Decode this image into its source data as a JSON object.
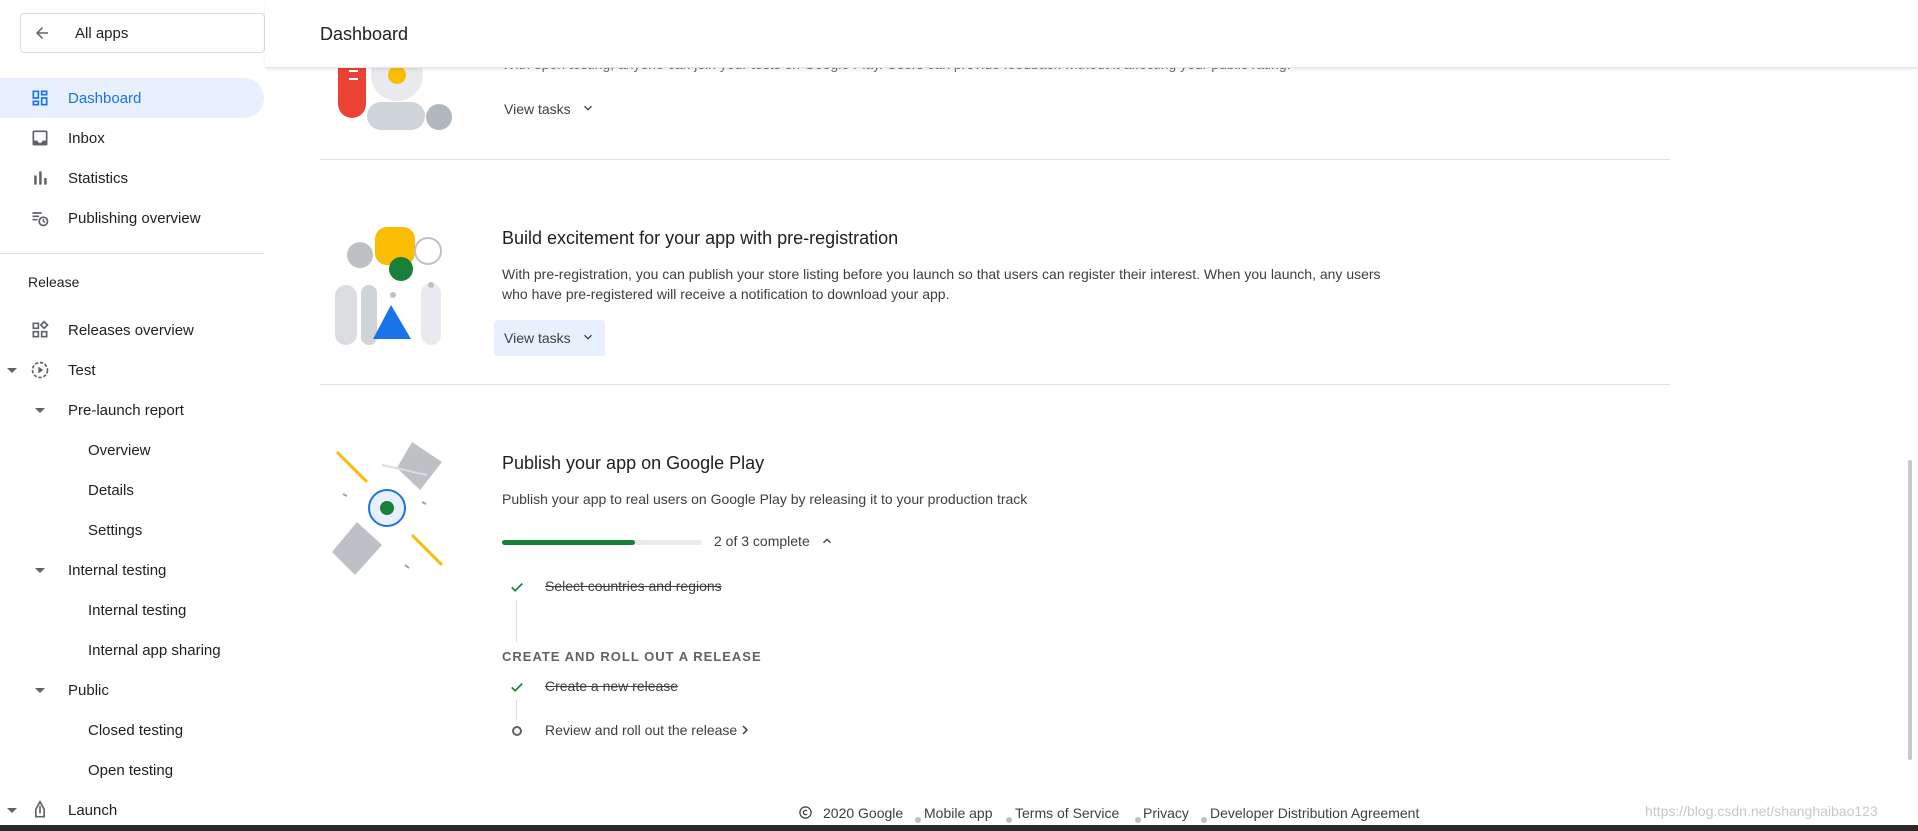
{
  "app": {
    "all_apps_label": "All apps",
    "page_title": "Dashboard"
  },
  "sidebar": {
    "items": [
      {
        "label": "Dashboard",
        "icon": "dashboard-icon"
      },
      {
        "label": "Inbox",
        "icon": "inbox-icon"
      },
      {
        "label": "Statistics",
        "icon": "bar-chart-icon"
      },
      {
        "label": "Publishing overview",
        "icon": "publishing-icon"
      }
    ],
    "release_section": "Release",
    "release_items": [
      {
        "label": "Releases overview",
        "icon": "releases-icon"
      },
      {
        "label": "Test",
        "icon": "play-icon"
      },
      {
        "label": "Pre-launch report"
      },
      {
        "label": "Overview"
      },
      {
        "label": "Details"
      },
      {
        "label": "Settings"
      },
      {
        "label": "Internal testing"
      },
      {
        "label": "Internal testing"
      },
      {
        "label": "Internal app sharing"
      },
      {
        "label": "Public"
      },
      {
        "label": "Closed testing"
      },
      {
        "label": "Open testing"
      },
      {
        "label": "Launch",
        "icon": "launch-icon"
      }
    ]
  },
  "main": {
    "card1": {
      "desc": "With open testing, anyone can join your tests on Google Play. Users can provide feedback without it affecting your public rating.",
      "view_tasks": "View tasks"
    },
    "card2": {
      "title": "Build excitement for your app with pre-registration",
      "desc": "With pre-registration, you can publish your store listing before you launch so that users can register their interest. When you launch, any users who have pre-registered will receive a notification to download your app.",
      "view_tasks": "View tasks"
    },
    "card3": {
      "title": "Publish your app on Google Play",
      "desc": "Publish your app to real users on Google Play by releasing it to your production track",
      "progress": 0.6667,
      "progress_text": "2 of 3 complete",
      "task1": "Select countries and regions",
      "group_label": "CREATE AND ROLL OUT A RELEASE",
      "task2": "Create a new release",
      "task3": "Review and roll out the release"
    }
  },
  "footer": {
    "copyright": "2020 Google",
    "mobile_app": "Mobile app",
    "terms": "Terms of Service",
    "privacy": "Privacy",
    "dda": "Developer Distribution Agreement"
  },
  "watermark": "https://blog.csdn.net/shanghaibao123",
  "colors": {
    "accent": "#1a73e8",
    "active_bg": "#e8f0fe",
    "progress": "#188038"
  }
}
